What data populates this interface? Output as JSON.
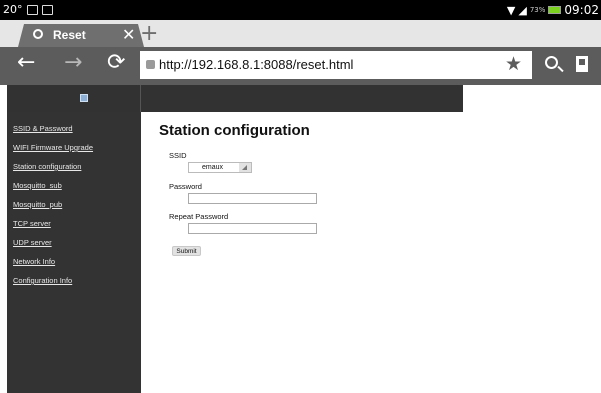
{
  "statusbar": {
    "temp": "20°",
    "battery_pct": "73%",
    "time": "09:02"
  },
  "tab": {
    "title": "Reset",
    "close": "✕",
    "new_tab": "+"
  },
  "toolbar": {
    "back": "←",
    "forward": "→",
    "reload": "⟳",
    "url": "http://192.168.8.1:8088/reset.html",
    "star": "★"
  },
  "sidebar": {
    "items": [
      "SSID & Password",
      "WIFI Firmware Upgrade",
      "Station configuration",
      "Mosquitto_sub",
      "Mosquitto_pub",
      "TCP server",
      "UDP server",
      "Network Info",
      "Configuration Info"
    ]
  },
  "main": {
    "title": "Station configuration",
    "ssid_label": "SSID",
    "ssid_value": "emaux",
    "password_label": "Password",
    "password_value": "",
    "repeat_label": "Repeat Password",
    "repeat_value": "",
    "submit_label": "Submit"
  }
}
